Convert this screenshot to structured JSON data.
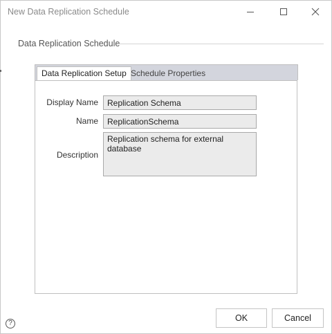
{
  "window": {
    "title": "New Data Replication Schedule"
  },
  "section": {
    "label": "Data Replication Schedule"
  },
  "tabs": [
    {
      "label": "Data Replication Setup",
      "active": true
    },
    {
      "label": "Schedule Properties",
      "active": false
    }
  ],
  "form": {
    "display_name": {
      "label": "Display Name",
      "value": "Replication Schema"
    },
    "name": {
      "label": "Name",
      "value": "ReplicationSchema"
    },
    "description": {
      "label": "Description",
      "value": "Replication schema for external database"
    }
  },
  "buttons": {
    "ok": "OK",
    "cancel": "Cancel"
  },
  "help": {
    "glyph": "?"
  },
  "icons": {
    "minimize": "minimize-icon",
    "maximize": "maximize-icon",
    "close": "close-icon",
    "help": "help-icon"
  }
}
